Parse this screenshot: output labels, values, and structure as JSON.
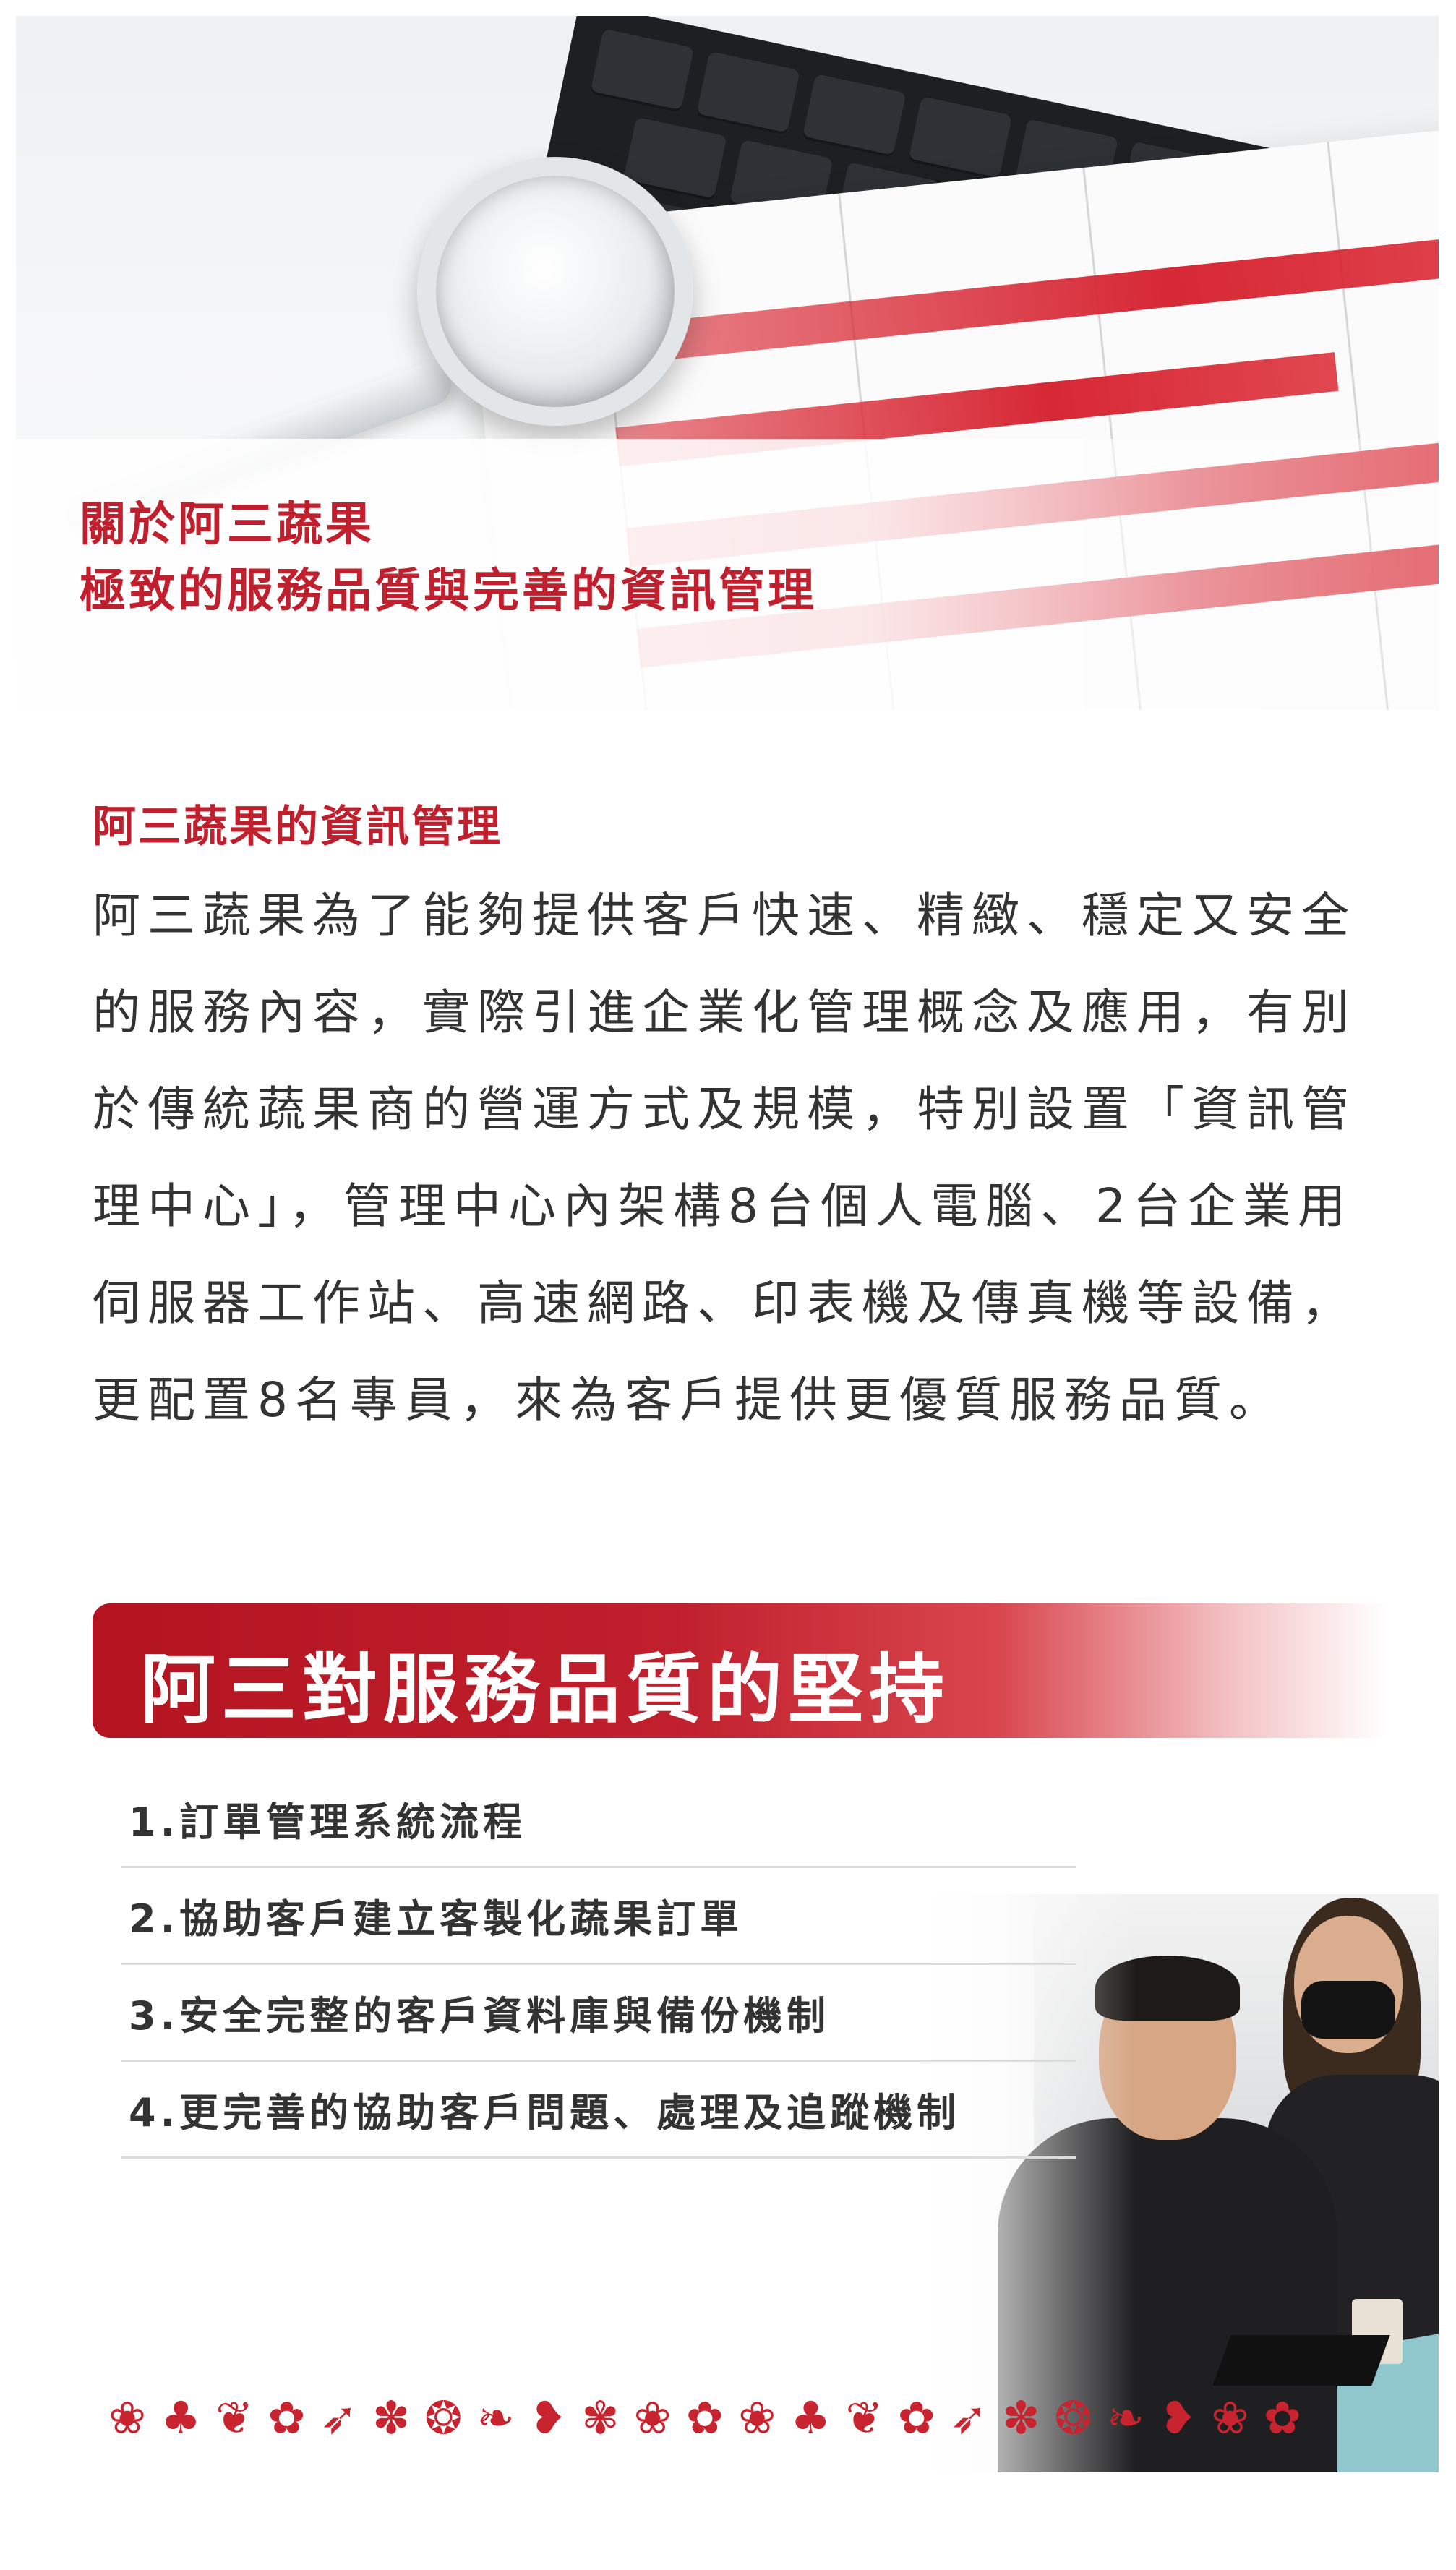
{
  "hero": {
    "title_line1": "關於阿三蔬果",
    "title_line2": "極致的服務品質與完善的資訊管理"
  },
  "info": {
    "heading": "阿三蔬果的資訊管理",
    "body": "阿三蔬果為了能夠提供客戶快速、精緻、穩定又安全的服務內容，實際引進企業化管理概念及應用，有別於傳統蔬果商的營運方式及規模，特別設置「資訊管理中心」，管理中心內架構8台個人電腦、2台企業用伺服器工作站、高速網路、印表機及傳真機等設備，更配置8名專員，來為客戶提供更優質服務品質。"
  },
  "commitment": {
    "title": "阿三對服務品質的堅持",
    "items": [
      "1.訂單管理系統流程",
      "2.協助客戶建立客製化蔬果訂單",
      "3.安全完整的客戶資料庫與備份機制",
      "4.更完善的協助客戶問題、處理及追蹤機制"
    ]
  },
  "colors": {
    "accent": "#c01f2e",
    "text": "#333333",
    "divider": "#dcdcdc"
  },
  "decorations": {
    "produce_border_icons": [
      "broccoli-icon",
      "mushroom-icon",
      "eggplant-icon",
      "pumpkin-icon",
      "carrot-icon",
      "tomato-icon",
      "onion-icon",
      "radish-icon",
      "pepper-icon",
      "cabbage-icon",
      "broccoli-icon",
      "pumpkin-icon",
      "broccoli-icon",
      "mushroom-icon",
      "eggplant-icon",
      "pumpkin-icon",
      "carrot-icon",
      "tomato-icon",
      "onion-icon",
      "radish-icon",
      "pepper-icon",
      "broccoli-icon",
      "pumpkin-icon"
    ]
  }
}
